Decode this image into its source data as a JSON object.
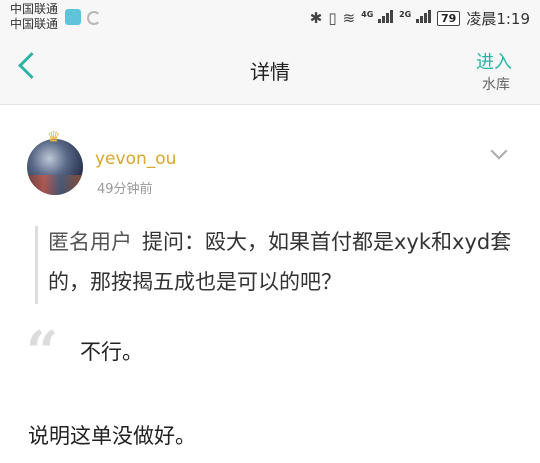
{
  "status_bar": {
    "carrier_1": "中国联通",
    "carrier_2": "中国联通",
    "network_1": "4G",
    "network_2": "2G",
    "battery": "79",
    "time": "凌晨1:19"
  },
  "header": {
    "title": "详情",
    "enter_label": "进入",
    "enter_sub": "水库"
  },
  "post": {
    "author": "yevon_ou",
    "time": "49分钟前",
    "asker": "匿名用户",
    "question": "提问：殴大，如果首付都是xyk和xyd套的，那按揭五成也是可以的吧？",
    "answer": "不行。",
    "explanation": "说明这单没做好。"
  }
}
